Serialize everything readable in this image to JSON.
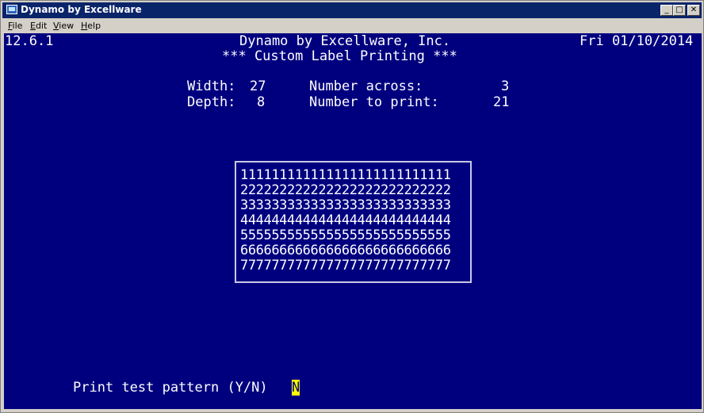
{
  "window": {
    "title": "Dynamo by Excellware",
    "menu": [
      "File",
      "Edit",
      "View",
      "Help"
    ],
    "menu_underline": [
      "F",
      "E",
      "V",
      "H"
    ]
  },
  "screen": {
    "version": "12.6.1",
    "company": "Dynamo by Excellware, Inc.",
    "date": "Fri 01/10/2014",
    "heading": "*** Custom Label Printing ***",
    "width_label": "Width:",
    "width_value": "27",
    "depth_label": "Depth:",
    "depth_value": "8",
    "across_label": "Number across:",
    "across_value": "3",
    "print_label": "Number to print:",
    "print_value": "21",
    "pattern_rows": [
      "111111111111111111111111111",
      "222222222222222222222222222",
      "333333333333333333333333333",
      "444444444444444444444444444",
      "555555555555555555555555555",
      "666666666666666666666666666",
      "777777777777777777777777777"
    ],
    "prompt": "Print test pattern (Y/N)",
    "answer": "N"
  }
}
